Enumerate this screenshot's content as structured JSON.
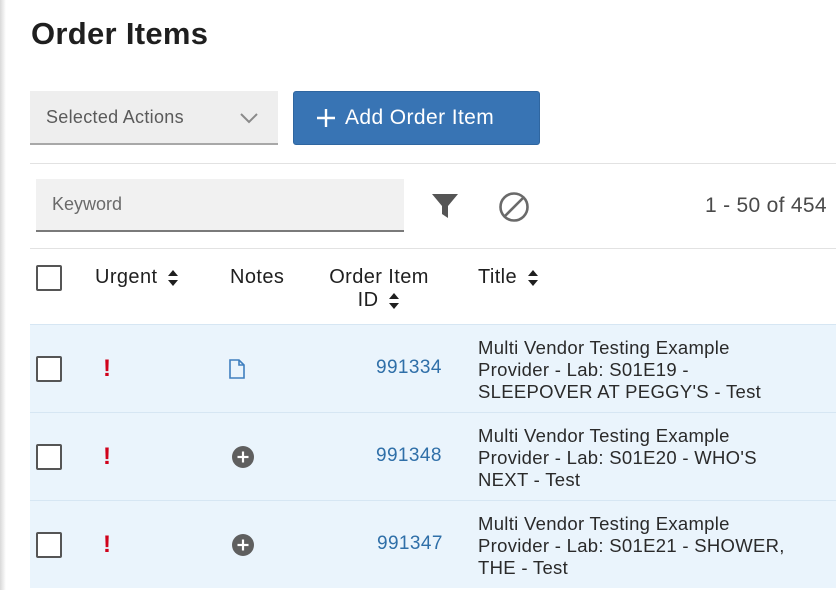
{
  "page": {
    "title": "Order Items"
  },
  "toolbar": {
    "selected_actions_label": "Selected Actions",
    "add_button_label": "Add Order Item",
    "accent_color": "#3874b4"
  },
  "filters": {
    "keyword_placeholder": "Keyword",
    "keyword_value": "",
    "pagination_text": "1 - 50 of 454"
  },
  "table": {
    "headers": {
      "urgent": "Urgent",
      "notes": "Notes",
      "order_item_line1": "Order Item",
      "order_item_line2": "ID",
      "title": "Title"
    },
    "rows": [
      {
        "urgent": "!",
        "notes_icon": "document-icon",
        "id": "991334",
        "title_lines": [
          "Multi Vendor Testing Example",
          "Provider - Lab: S01E19 -",
          "SLEEPOVER AT PEGGY'S - Test"
        ]
      },
      {
        "urgent": "!",
        "notes_icon": "add-circle-icon",
        "id": "991348",
        "title_lines": [
          "Multi Vendor Testing Example",
          "Provider - Lab: S01E20 - WHO'S",
          "NEXT - Test"
        ]
      },
      {
        "urgent": "!",
        "notes_icon": "add-circle-icon",
        "id": "991347",
        "title_lines": [
          "Multi Vendor Testing Example",
          "Provider - Lab: S01E21 - SHOWER,",
          "THE - Test"
        ]
      }
    ]
  },
  "colors": {
    "urgent": "#d0021b",
    "link": "#2f6fa8",
    "row_highlight": "#eaf4fc"
  }
}
